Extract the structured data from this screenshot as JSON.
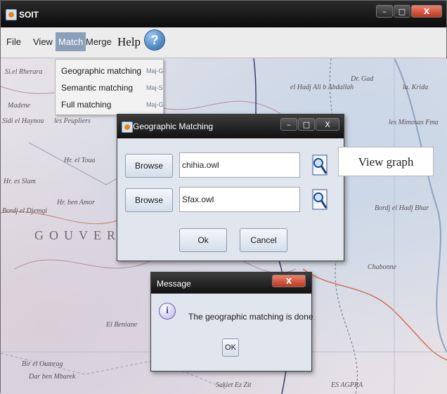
{
  "window": {
    "title": "SOIT",
    "min_glyph": "–",
    "max_glyph": "□",
    "close_glyph": "X"
  },
  "menubar": {
    "file": "File",
    "view": "View",
    "match": "Match",
    "merge": "Merge",
    "help": "Help",
    "help_icon_glyph": "?"
  },
  "match_menu": {
    "items": [
      {
        "label": "Geographic matching",
        "accel": "Maj-G"
      },
      {
        "label": "Semantic matching",
        "accel": "Maj-S"
      },
      {
        "label": "Full matching",
        "accel": "Maj-G"
      }
    ]
  },
  "map": {
    "labels": [
      "Si.el Rherara",
      "Madene",
      "Sidi el Haynou",
      "les Peupliers",
      "Hr. el Toua",
      "Hr. es Slam",
      "Bordj el Djemgi",
      "GOUVERN",
      "Dr. Gad",
      "el Hadj Ali b Abdallah",
      "la. Krida",
      "Hr. ben Amor",
      "Bordj el Hadj Bhar",
      "Chabonne",
      "El Beniane",
      "Bir el Oumrag",
      "Dar ben Mbarek",
      "Sakiet Ez Zit",
      "ES AGPRA",
      "les Mimosas Fma"
    ]
  },
  "geo_dialog": {
    "title": "Geographic Matching",
    "browse1": "Browse",
    "file1": "chihia.owl",
    "browse2": "Browse",
    "file2": "Sfax.owl",
    "ok": "Ok",
    "cancel": "Cancel",
    "min_glyph": "–",
    "max_glyph": "□",
    "close_glyph": "X"
  },
  "view_graph": "View graph",
  "message_dialog": {
    "title": "Message",
    "text": "The geographic matching is done",
    "ok": "OK",
    "info_glyph": "i",
    "close_glyph": "X"
  }
}
